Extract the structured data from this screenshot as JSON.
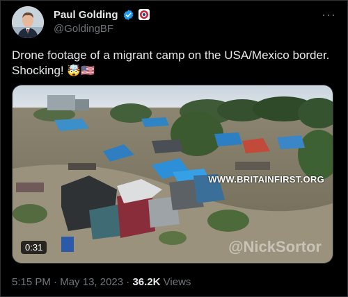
{
  "author": {
    "display_name": "Paul Golding",
    "handle": "@GoldingBF",
    "avatar_icon": "profile-photo",
    "verified_icon": "verified-badge-icon",
    "affiliation_icon": "affiliation-badge-icon"
  },
  "tweet": {
    "text_line1": "Drone footage of a migrant camp on the USA/Mexico border.",
    "text_line2": "Shocking!",
    "emojis": "🤯🇺🇸"
  },
  "media": {
    "duration": "0:31",
    "watermark_site": "WWW.BRITAINFIRST.ORG",
    "watermark_user": "@NickSortor"
  },
  "meta": {
    "time": "5:15 PM",
    "separator1": " · ",
    "date": "May 13, 2023",
    "separator2": " · ",
    "views_count": "36.2K",
    "views_label": " Views"
  },
  "colors": {
    "background": "#000000",
    "text": "#e7e9ea",
    "secondary": "#71767b",
    "verified": "#1d9bf0"
  }
}
